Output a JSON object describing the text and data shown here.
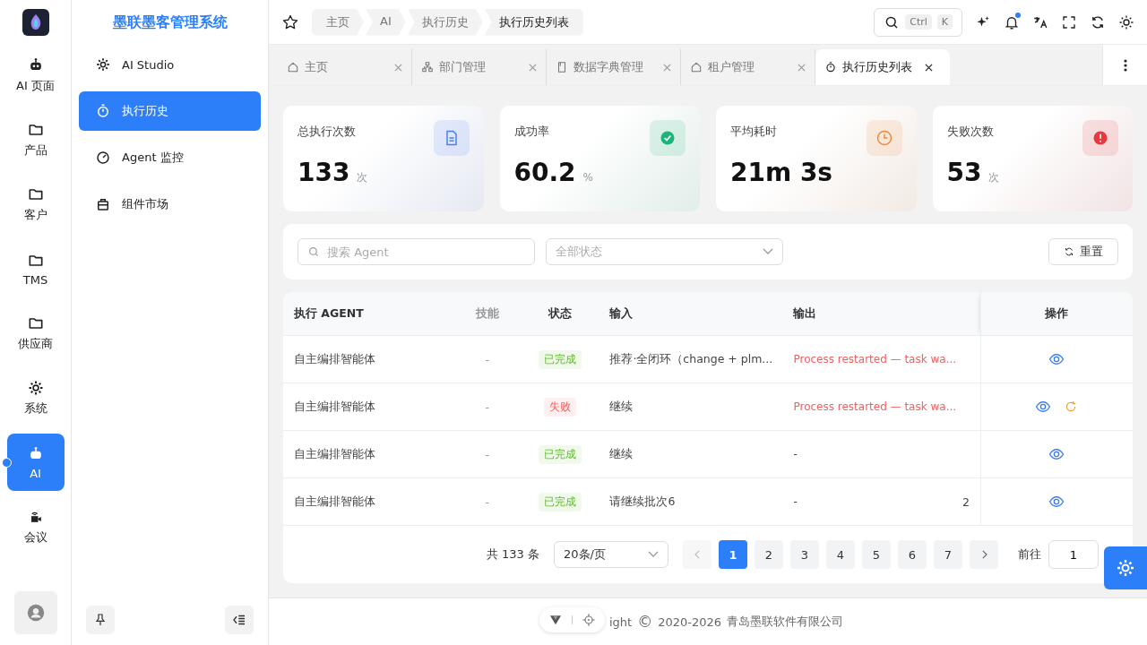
{
  "rail": {
    "items": [
      {
        "label": "AI 页面",
        "selected": false
      },
      {
        "label": "产品",
        "selected": false
      },
      {
        "label": "客户",
        "selected": false
      },
      {
        "label": "TMS",
        "selected": false
      },
      {
        "label": "供应商",
        "selected": false
      },
      {
        "label": "系统",
        "selected": false
      },
      {
        "label": "AI",
        "selected": true
      },
      {
        "label": "会议",
        "selected": false
      }
    ]
  },
  "sidebar": {
    "title": "墨联墨客管理系统",
    "items": [
      {
        "label": "AI Studio",
        "selected": false
      },
      {
        "label": "执行历史",
        "selected": true
      },
      {
        "label": "Agent 监控",
        "selected": false
      },
      {
        "label": "组件市场",
        "selected": false
      }
    ]
  },
  "breadcrumb": [
    "主页",
    "AI",
    "执行历史",
    "执行历史列表"
  ],
  "search": {
    "keys": [
      "Ctrl",
      "K"
    ]
  },
  "notifications": {
    "unread": true
  },
  "tabs": [
    {
      "label": "主页",
      "selected": false
    },
    {
      "label": "部门管理",
      "selected": false
    },
    {
      "label": "数据字典管理",
      "selected": false
    },
    {
      "label": "租户管理",
      "selected": false
    },
    {
      "label": "执行历史列表",
      "selected": true
    }
  ],
  "stats": [
    {
      "label": "总执行次数",
      "value": "133",
      "unit": "次",
      "color": "#4d7cf5"
    },
    {
      "label": "成功率",
      "value": "60.2",
      "unit": "%",
      "color": "#19b57a"
    },
    {
      "label": "平均耗时",
      "value": "21m 3s",
      "color": "#f08a3c"
    },
    {
      "label": "失败次数",
      "value": "53",
      "unit": "次",
      "color": "#e8383d"
    }
  ],
  "filters": {
    "search_placeholder": "搜索 Agent",
    "status_placeholder": "全部状态",
    "reset": "重置"
  },
  "table": {
    "columns": [
      "执行 AGENT",
      "技能",
      "状态",
      "输入",
      "输出",
      "操作"
    ],
    "rows": [
      {
        "agent": "自主编排智能体",
        "skill": "-",
        "status": {
          "text": "已完成",
          "color": "#5dbb2e"
        },
        "input": "推荐·全闭环（change + plm...",
        "output": {
          "text": "Process restarted — task wa...",
          "color": "#f06060"
        },
        "retry": false
      },
      {
        "agent": "自主编排智能体",
        "skill": "-",
        "status": {
          "text": "失败",
          "color": "#f06060"
        },
        "input": "继续",
        "output": {
          "text": "Process restarted — task wa...",
          "color": "#f06060"
        },
        "retry": true
      },
      {
        "agent": "自主编排智能体",
        "skill": "-",
        "status": {
          "text": "已完成",
          "color": "#5dbb2e"
        },
        "input": "继续",
        "output": {
          "text": "-"
        },
        "retry": false
      },
      {
        "agent": "自主编排智能体",
        "skill": "-",
        "status": {
          "text": "已完成",
          "color": "#5dbb2e"
        },
        "input": "请继续批次6",
        "output": {
          "text": "-"
        },
        "column_6": "2",
        "retry": false
      }
    ]
  },
  "pagination": {
    "total": "共 133 条",
    "page_size": "20条/页",
    "pages": [
      {
        "label": "1",
        "selected": true
      },
      {
        "label": "2",
        "selected": false
      },
      {
        "label": "3",
        "selected": false
      },
      {
        "label": "4",
        "selected": false
      },
      {
        "label": "5",
        "selected": false
      },
      {
        "label": "6",
        "selected": false
      },
      {
        "label": "7",
        "selected": false
      }
    ],
    "goto_label": "前往",
    "goto_value": "1"
  },
  "footer": {
    "copyright_tail": "ight",
    "symbol": "©",
    "years": "2020-2026",
    "company": "青岛墨联软件有限公司"
  }
}
